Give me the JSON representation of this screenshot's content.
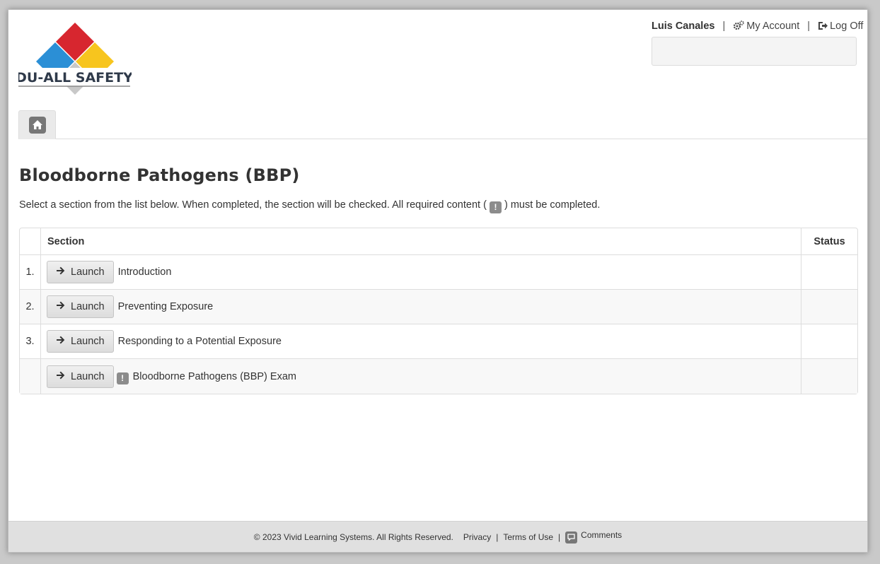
{
  "header": {
    "logo_text": "DU-ALL SAFETY",
    "user_name": "Luis Canales",
    "my_account_label": "My Account",
    "log_off_label": "Log Off",
    "separator": "|"
  },
  "nav": {
    "home_icon": "home-icon"
  },
  "page": {
    "title": "Bloodborne Pathogens (BBP)",
    "intro_before": "Select a section from the list below. When completed, the section will be checked. All required content (",
    "intro_after": ") must be completed.",
    "required_marker": "!"
  },
  "table": {
    "headers": {
      "number": "",
      "section": "Section",
      "status": "Status"
    },
    "launch_label": "Launch",
    "rows": [
      {
        "number": "1.",
        "title": "Introduction",
        "required": false,
        "status": ""
      },
      {
        "number": "2.",
        "title": "Preventing Exposure",
        "required": false,
        "status": ""
      },
      {
        "number": "3.",
        "title": "Responding to a Potential Exposure",
        "required": false,
        "status": ""
      },
      {
        "number": "",
        "title": "Bloodborne Pathogens (BBP) Exam",
        "required": true,
        "status": ""
      }
    ]
  },
  "footer": {
    "copyright": "© 2023 Vivid Learning Systems. All Rights Reserved.",
    "privacy": "Privacy",
    "terms": "Terms of Use",
    "comments": "Comments",
    "separator": "|"
  },
  "colors": {
    "logo_red": "#d7262f",
    "logo_blue": "#2b8fd6",
    "logo_yellow": "#f7c51e",
    "logo_gray": "#bfbfbf",
    "footer_bg": "#e0e0e0"
  }
}
